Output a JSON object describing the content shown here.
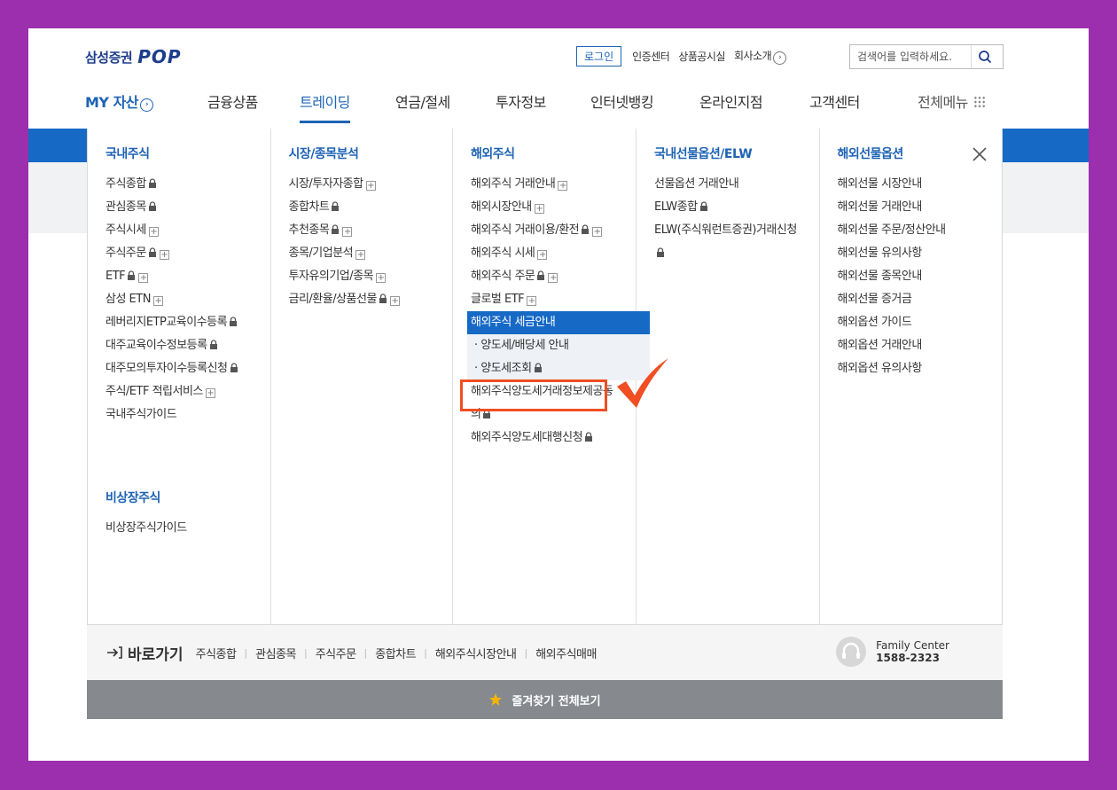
{
  "header": {
    "logo_text": "삼성증권",
    "logo_pop": "POP",
    "login": "로그인",
    "util_links": [
      "인증센터",
      "상품공시실",
      "회사소개"
    ],
    "search_placeholder": "검색어를 입력하세요."
  },
  "gnb": {
    "my_assets": "MY 자산",
    "items": [
      "금융상품",
      "트레이딩",
      "연금/절세",
      "투자정보",
      "인터넷뱅킹",
      "온라인지점",
      "고객센터"
    ],
    "active": "트레이딩",
    "all_menu": "전체메뉴"
  },
  "mega": {
    "col1": {
      "title": "국내주식",
      "items": [
        {
          "label": "주식종합",
          "lock": true,
          "plus": false
        },
        {
          "label": "관심종목",
          "lock": true,
          "plus": false
        },
        {
          "label": "주식시세",
          "lock": false,
          "plus": true
        },
        {
          "label": "주식주문",
          "lock": true,
          "plus": true
        },
        {
          "label": "ETF",
          "lock": true,
          "plus": true
        },
        {
          "label": "삼성 ETN",
          "lock": false,
          "plus": true
        },
        {
          "label": "레버리지ETP교육이수등록",
          "lock": true,
          "plus": false
        },
        {
          "label": "대주교육이수정보등록",
          "lock": true,
          "plus": false
        },
        {
          "label": "대주모의투자이수등록신청",
          "lock": true,
          "plus": false
        },
        {
          "label": "주식/ETF 적립서비스",
          "lock": false,
          "plus": true
        },
        {
          "label": "국내주식가이드",
          "lock": false,
          "plus": false
        }
      ],
      "sub_title": "비상장주식",
      "sub_items": [
        "비상장주식가이드"
      ]
    },
    "col2": {
      "title": "시장/종목분석",
      "items": [
        {
          "label": "시장/투자자종합",
          "lock": false,
          "plus": true
        },
        {
          "label": "종합차트",
          "lock": true,
          "plus": false
        },
        {
          "label": "추천종목",
          "lock": true,
          "plus": true
        },
        {
          "label": "종목/기업분석",
          "lock": false,
          "plus": true
        },
        {
          "label": "투자유의기업/종목",
          "lock": false,
          "plus": true
        },
        {
          "label": "금리/환율/상품선물",
          "lock": true,
          "plus": true
        }
      ]
    },
    "col3": {
      "title": "해외주식",
      "items": [
        {
          "label": "해외주식 거래안내",
          "lock": false,
          "plus": true
        },
        {
          "label": "해외시장안내",
          "lock": false,
          "plus": true
        },
        {
          "label": "해외주식 거래이용/환전",
          "lock": true,
          "plus": true
        },
        {
          "label": "해외주식 시세",
          "lock": false,
          "plus": true
        },
        {
          "label": "해외주식 주문",
          "lock": true,
          "plus": true
        },
        {
          "label": "글로벌 ETF",
          "lock": false,
          "plus": true
        }
      ],
      "active_item": "해외주식 세금안내",
      "sub_items": [
        "양도세/배당세 안내",
        "양도세조회"
      ],
      "after_items": [
        {
          "label": "해외주식양도세거래정보제공동의",
          "lock": true
        },
        {
          "label": "해외주식양도세대행신청",
          "lock": true
        }
      ]
    },
    "col4": {
      "title": "국내선물옵션/ELW",
      "items": [
        {
          "label": "선물옵션 거래안내",
          "lock": false
        },
        {
          "label": "ELW종합",
          "lock": true
        },
        {
          "label": "ELW(주식워런트증권)거래신청",
          "lock": true
        }
      ]
    },
    "col5": {
      "title": "해외선물옵션",
      "items": [
        "해외선물 시장안내",
        "해외선물 거래안내",
        "해외선물 주문/정산안내",
        "해외선물 유의사항",
        "해외선물 종목안내",
        "해외선물 증거금",
        "해외옵션 가이드",
        "해외옵션 거래안내",
        "해외옵션 유의사항"
      ]
    }
  },
  "footer": {
    "go_label": "바로가기",
    "links": [
      "주식종합",
      "관심종목",
      "주식주문",
      "종합차트",
      "해외주식시장안내",
      "해외주식매매"
    ],
    "family_label": "Family Center",
    "family_number": "1588-2323",
    "favorites": "즐겨찾기 전체보기"
  },
  "colors": {
    "brand_blue": "#1769c6",
    "highlight": "#f04e23",
    "background": "#9b2fae"
  }
}
